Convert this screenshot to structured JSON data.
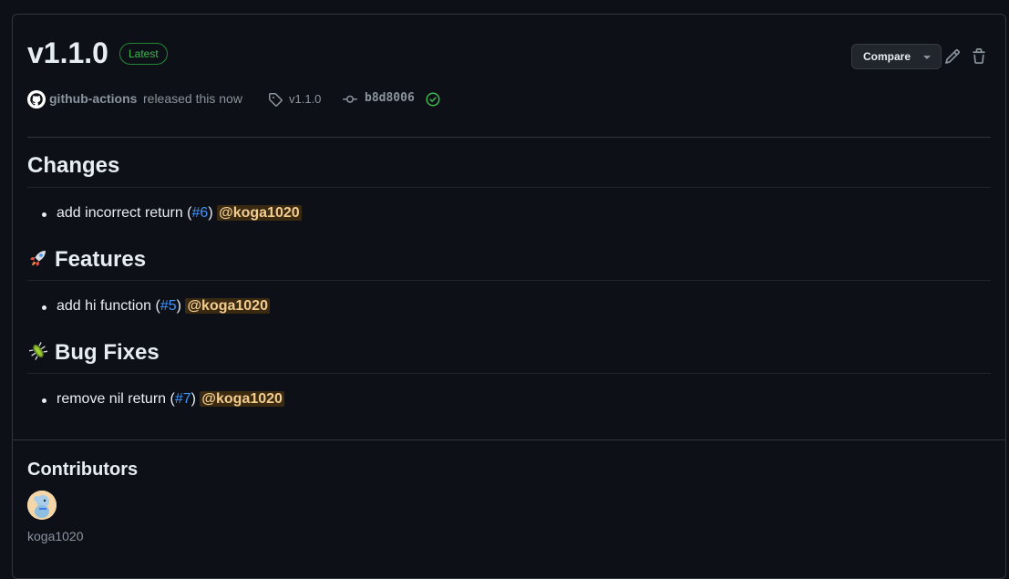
{
  "release": {
    "version": "v1.1.0",
    "badge": "Latest",
    "compare_label": "Compare",
    "author": "github-actions",
    "released_text": "released this now",
    "tag": "v1.1.0",
    "commit": "b8d8006"
  },
  "sections": [
    {
      "title": "Changes",
      "emoji": "",
      "items": [
        {
          "text": "add incorrect return (",
          "pr": "#6",
          "close": ")",
          "mention": "@koga1020"
        }
      ]
    },
    {
      "title": "Features",
      "emoji": "rocket-icon",
      "items": [
        {
          "text": "add hi function (",
          "pr": "#5",
          "close": ")",
          "mention": "@koga1020"
        }
      ]
    },
    {
      "title": "Bug Fixes",
      "emoji": "bug-icon",
      "items": [
        {
          "text": "remove nil return (",
          "pr": "#7",
          "close": ")",
          "mention": "@koga1020"
        }
      ]
    }
  ],
  "contributors": {
    "title": "Contributors",
    "users": [
      {
        "name": "koga1020"
      }
    ]
  },
  "colors": {
    "background": "#0d1117",
    "border": "#30363d",
    "link": "#4493f8",
    "success": "#3fb950",
    "mention_bg": "#3b2a12",
    "mention_fg": "#f2cc8f"
  }
}
